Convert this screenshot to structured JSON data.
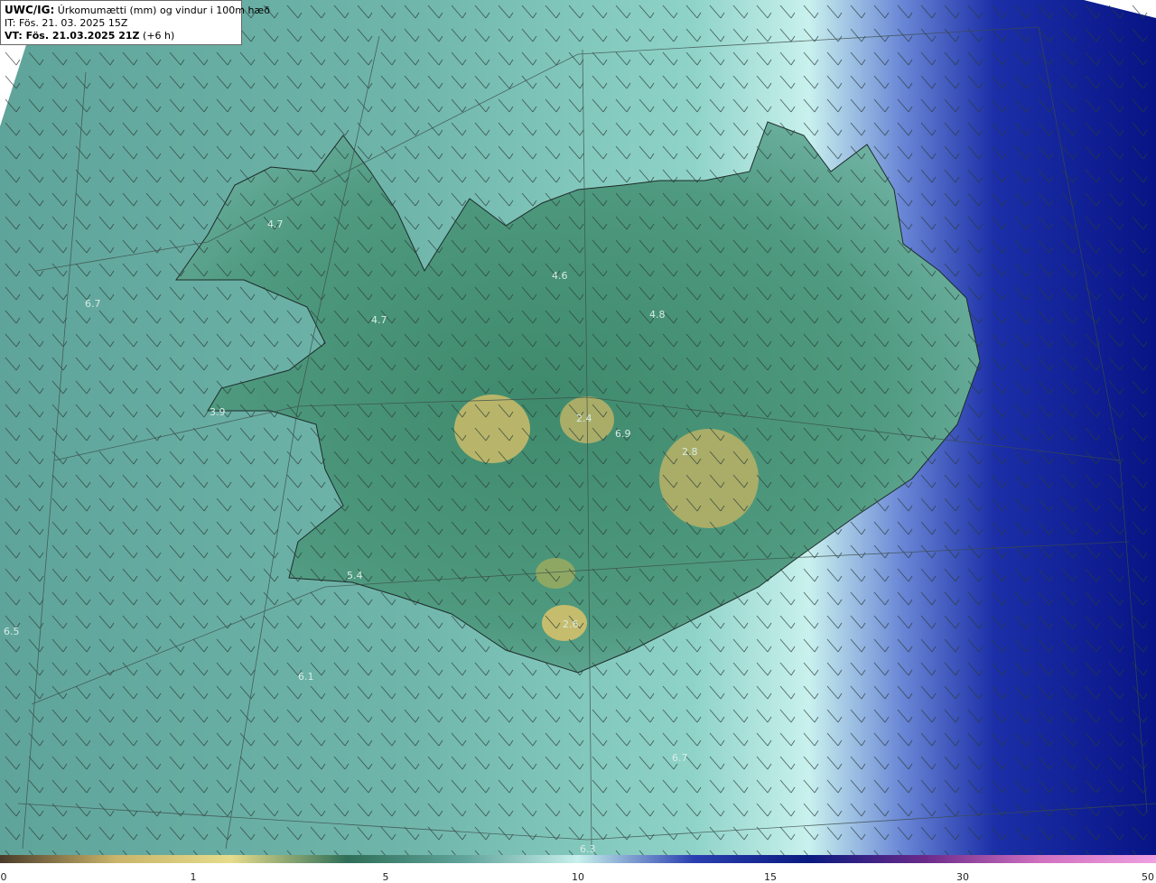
{
  "title": {
    "model": "UWC/IG:",
    "description": "Úrkomumætti (mm) og vindur i 100m hæð",
    "init_time": "IT: Fös. 21. 03. 2025 15Z",
    "valid_label": "VT: Fös. 21.03.2025 21Z",
    "valid_offset": "(+6 h)"
  },
  "map_values": [
    {
      "id": "v1",
      "text": "4.7"
    },
    {
      "id": "v2",
      "text": "4.7"
    },
    {
      "id": "v3",
      "text": "6.7"
    },
    {
      "id": "v4",
      "text": "3.9"
    },
    {
      "id": "v5",
      "text": "4.6"
    },
    {
      "id": "v6",
      "text": "4.8"
    },
    {
      "id": "v7",
      "text": "2.4"
    },
    {
      "id": "v8",
      "text": "6.9"
    },
    {
      "id": "v9",
      "text": "2.8"
    },
    {
      "id": "v10",
      "text": "5.4"
    },
    {
      "id": "v11",
      "text": "2.6"
    },
    {
      "id": "v12",
      "text": "6.1"
    },
    {
      "id": "v13",
      "text": "6.5"
    },
    {
      "id": "v14",
      "text": "6.7"
    },
    {
      "id": "v15",
      "text": "6.3"
    }
  ],
  "colorbar": {
    "ticks": [
      "0",
      "1",
      "5",
      "10",
      "15",
      "30",
      "50"
    ],
    "colors": [
      "#4a3b2a",
      "#c9b46a",
      "#e6dc8c",
      "#2f6f58",
      "#5fa39a",
      "#c8f0ec",
      "#2a3fb0",
      "#0a1a80",
      "#6a2a8a",
      "#d070c0",
      "#f0a0e0"
    ]
  }
}
